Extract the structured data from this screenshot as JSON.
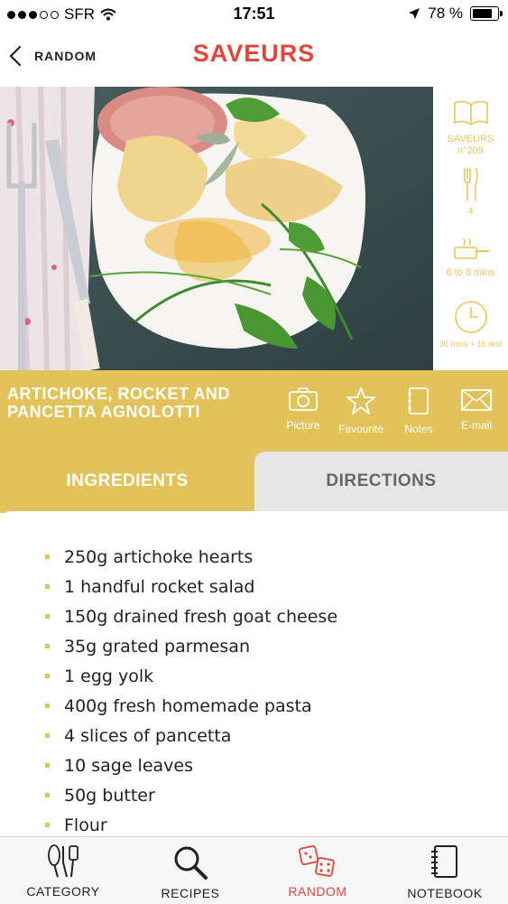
{
  "status_bar": {
    "carrier": "SFR",
    "time": "17:51",
    "battery": "78 %"
  },
  "nav": {
    "back_label": "RANDOM",
    "title": "SAVEURS"
  },
  "sidebar": {
    "magazine": "SAVEURS\nn°209",
    "servings": "4",
    "cook_time": "6 to 8 mins",
    "total_time": "30 mins + 1h rest"
  },
  "recipe": {
    "title": "ARTICHOKE, ROCKET AND PANCETTA AGNOLOTTI",
    "actions": {
      "picture": "Picture",
      "favourite": "Favourite",
      "notes": "Notes",
      "email": "E-mail"
    }
  },
  "tabs": {
    "ingredients": "INGREDIENTS",
    "directions": "DIRECTIONS"
  },
  "ingredients": [
    "250g artichoke hearts",
    "1 handful rocket salad",
    "150g drained fresh goat cheese",
    "35g grated parmesan",
    "1 egg yolk",
    "400g fresh homemade pasta",
    "4 slices of pancetta",
    "10 sage leaves",
    "50g butter",
    "Flour"
  ],
  "tabbar": {
    "category": "CATEGORY",
    "recipes": "RECIPES",
    "random": "RANDOM",
    "notebook": "NOTEBOOK"
  },
  "colors": {
    "accent_red": "#e0463d",
    "accent_yellow": "#e2c25a"
  },
  "icons": [
    "chevron-left-icon",
    "book-icon",
    "fork-knife-icon",
    "pan-icon",
    "clock-icon",
    "camera-icon",
    "star-icon",
    "notes-icon",
    "email-icon",
    "whisk-icon",
    "magnifier-icon",
    "dice-icon",
    "notebook-icon"
  ]
}
